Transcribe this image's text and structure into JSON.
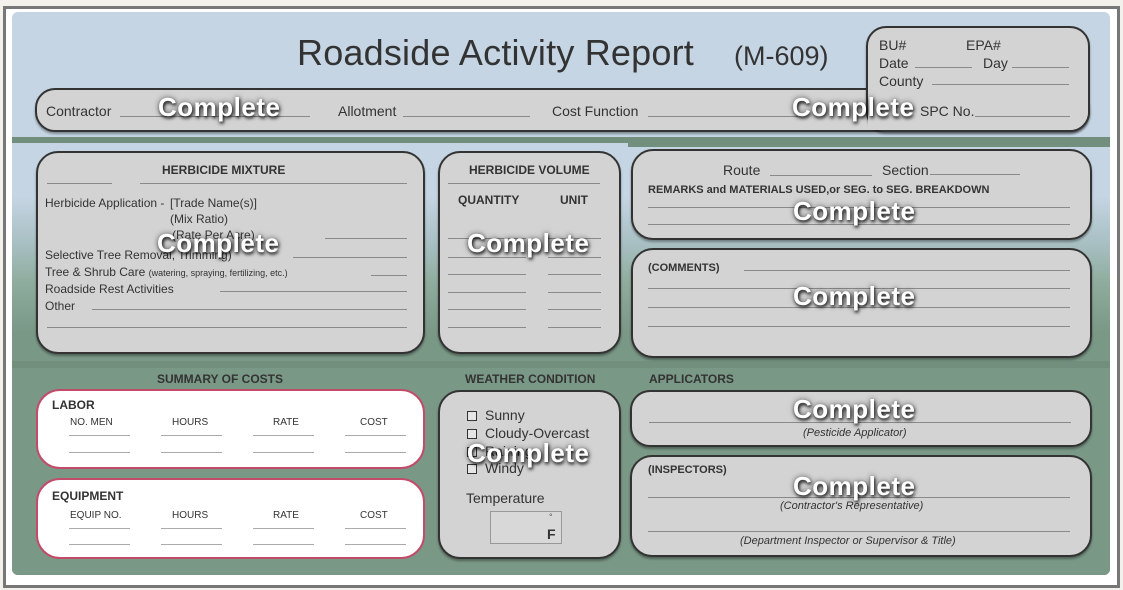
{
  "header": {
    "title": "Roadside Activity Report",
    "form_code": "(M-609)",
    "fields": {
      "contractor_label": "Contractor",
      "contractor_value": "Complete",
      "allotment_label": "Allotment",
      "cost_function_label": "Cost Function",
      "cost_function_value": "Complete",
      "spc_label": "SPC No."
    },
    "id_box": {
      "bu_label": "BU#",
      "epa_label": "EPA#",
      "date_label": "Date",
      "day_label": "Day",
      "county_label": "County"
    }
  },
  "herbicide_mixture": {
    "title": "HERBICIDE MIXTURE",
    "application_label": "Herbicide Application -",
    "application_sub": [
      "[Trade Name(s)]",
      "(Mix Ratio)",
      "(Rate Per Acre)"
    ],
    "items": [
      {
        "label": "Selective Tree Removal, Trimming)"
      },
      {
        "label": "Tree & Shrub Care",
        "note": "(watering, spraying, fertilizing, etc.)"
      },
      {
        "label": "Roadside Rest Activities"
      },
      {
        "label": "Other"
      }
    ],
    "value": "Complete"
  },
  "herbicide_volume": {
    "title": "HERBICIDE VOLUME",
    "quantity_label": "QUANTITY",
    "unit_label": "UNIT",
    "value": "Complete"
  },
  "remarks": {
    "route_label": "Route",
    "section_label": "Section",
    "title": "REMARKS and MATERIALS USED,or SEG. to SEG. BREAKDOWN",
    "value": "Complete"
  },
  "comments": {
    "title": "(COMMENTS)",
    "value": "Complete"
  },
  "summary_of_costs": {
    "title": "SUMMARY OF COSTS",
    "labor": {
      "title": "LABOR",
      "columns": [
        "NO. MEN",
        "HOURS",
        "RATE",
        "COST"
      ]
    },
    "equipment": {
      "title": "EQUIPMENT",
      "columns": [
        "EQUIP NO.",
        "HOURS",
        "RATE",
        "COST"
      ]
    }
  },
  "weather": {
    "title": "WEATHER CONDITION",
    "options": [
      "Sunny",
      "Cloudy-Overcast",
      "Raining",
      "Windy"
    ],
    "value": "Complete",
    "temperature_label": "Temperature",
    "degree_symbol": "°",
    "unit": "F"
  },
  "applicators": {
    "title": "APPLICATORS",
    "value": "Complete",
    "caption": "(Pesticide Applicator)"
  },
  "inspectors": {
    "title": "(INSPECTORS)",
    "value": "Complete",
    "caption_contractor": "(Contractor's Representative)",
    "caption_department": "(Department Inspector or Supervisor & Title)"
  }
}
